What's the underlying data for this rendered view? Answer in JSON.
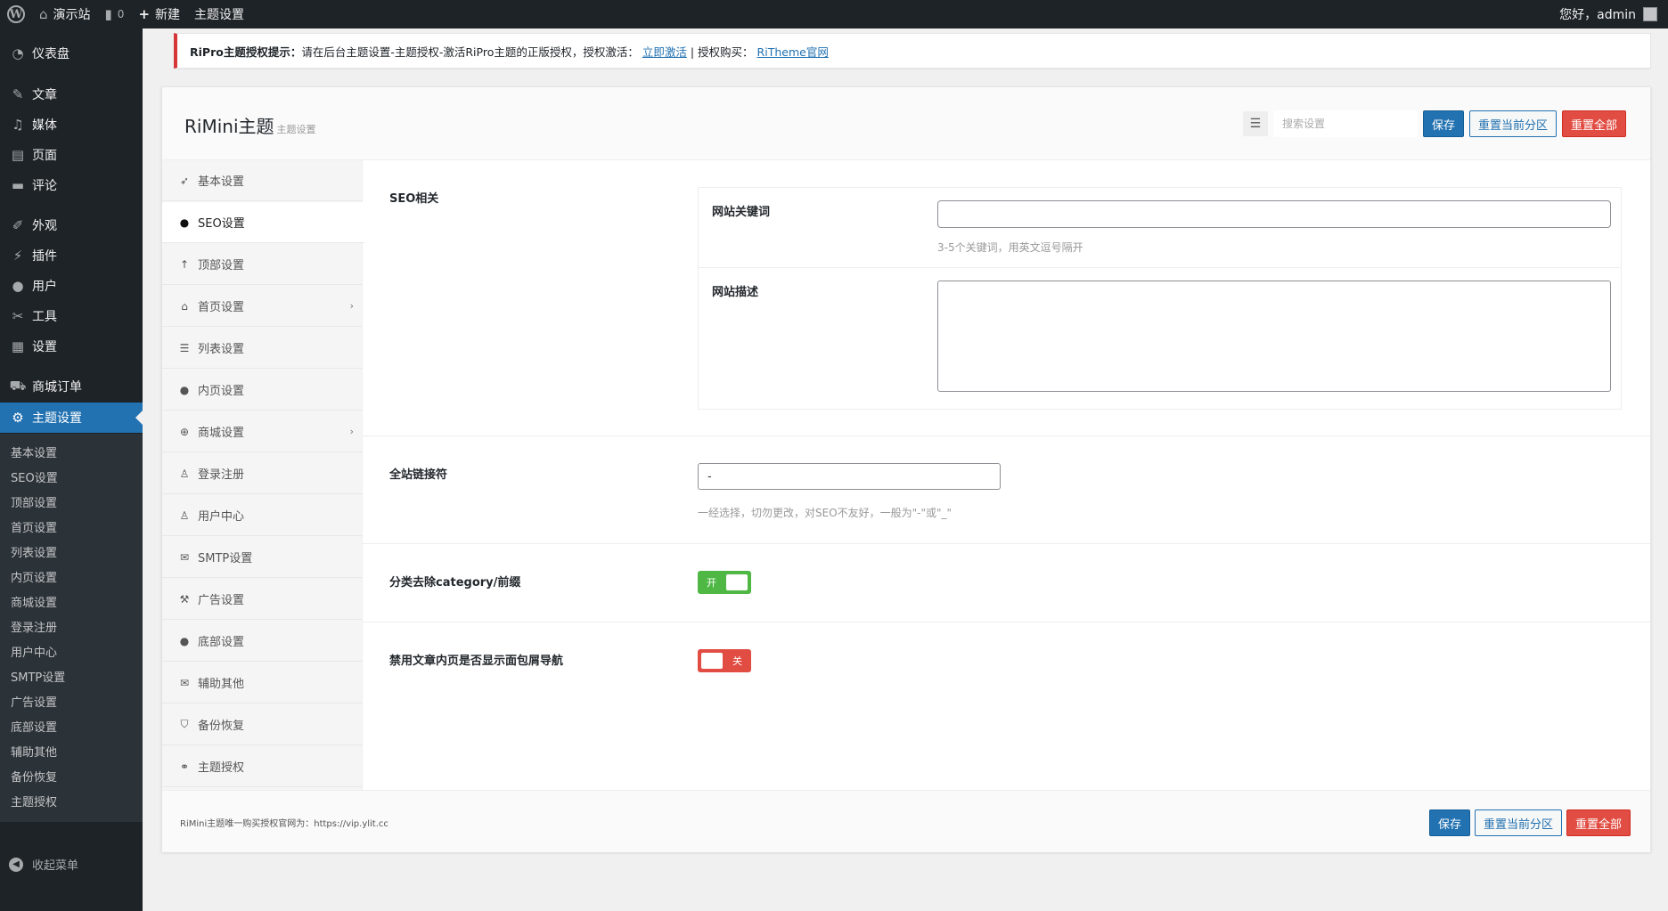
{
  "adminbar": {
    "site_name": "演示站",
    "comments_count": "0",
    "new_label": "新建",
    "theme_settings_label": "主题设置",
    "greeting": "您好，admin"
  },
  "sidebar": {
    "items": [
      {
        "label": "仪表盘",
        "icon": "dashboard-icon"
      },
      {
        "label": "文章",
        "icon": "pin-icon"
      },
      {
        "label": "媒体",
        "icon": "media-icon"
      },
      {
        "label": "页面",
        "icon": "page-icon"
      },
      {
        "label": "评论",
        "icon": "comment-icon"
      },
      {
        "label": "外观",
        "icon": "brush-icon"
      },
      {
        "label": "插件",
        "icon": "plugin-icon"
      },
      {
        "label": "用户",
        "icon": "user-icon"
      },
      {
        "label": "工具",
        "icon": "wrench-icon"
      },
      {
        "label": "设置",
        "icon": "settings-icon"
      },
      {
        "label": "商城订单",
        "icon": "cart-icon"
      },
      {
        "label": "主题设置",
        "icon": "gear-icon"
      }
    ],
    "submenu": [
      "基本设置",
      "SEO设置",
      "顶部设置",
      "首页设置",
      "列表设置",
      "内页设置",
      "商城设置",
      "登录注册",
      "用户中心",
      "SMTP设置",
      "广告设置",
      "底部设置",
      "辅助其他",
      "备份恢复",
      "主题授权"
    ],
    "collapse_label": "收起菜单"
  },
  "notice": {
    "title": "RiPro主题授权提示：",
    "text": "请在后台主题设置-主题授权-激活RiPro主题的正版授权，授权激活：",
    "activate_link": "立即激活",
    "separator": "| 授权购买：",
    "official_link": "RiTheme官网"
  },
  "panel": {
    "title": "RiMini主题",
    "subtitle": "主题设置",
    "search_placeholder": "搜索设置",
    "save_label": "保存",
    "reset_section_label": "重置当前分区",
    "reset_all_label": "重置全部"
  },
  "nav": {
    "items": [
      {
        "label": "基本设置",
        "icon": "rocket-icon"
      },
      {
        "label": "SEO设置",
        "icon": "dot-icon"
      },
      {
        "label": "顶部设置",
        "icon": "arrow-up-icon"
      },
      {
        "label": "首页设置",
        "icon": "home-icon"
      },
      {
        "label": "列表设置",
        "icon": "list-icon"
      },
      {
        "label": "内页设置",
        "icon": "dot-icon"
      },
      {
        "label": "商城设置",
        "icon": "plus-circle-icon"
      },
      {
        "label": "登录注册",
        "icon": "person-icon"
      },
      {
        "label": "用户中心",
        "icon": "person-icon"
      },
      {
        "label": "SMTP设置",
        "icon": "envelope-icon"
      },
      {
        "label": "广告设置",
        "icon": "gavel-icon"
      },
      {
        "label": "底部设置",
        "icon": "dot-icon"
      },
      {
        "label": "辅助其他",
        "icon": "envelope-icon"
      },
      {
        "label": "备份恢复",
        "icon": "shield-icon"
      },
      {
        "label": "主题授权",
        "icon": "handshake-icon"
      }
    ]
  },
  "content": {
    "seo_section_title": "SEO相关",
    "keywords_label": "网站关键词",
    "keywords_value": "",
    "keywords_desc": "3-5个关键词，用英文逗号隔开",
    "description_label": "网站描述",
    "description_value": "",
    "connector_title": "全站链接符",
    "connector_value": "-",
    "connector_desc": "一经选择，切勿更改，对SEO不友好，一般为\"-\"或\"_\"",
    "category_title": "分类去除category/前缀",
    "category_switch_label": "开",
    "breadcrumb_title": "禁用文章内页是否显示面包屑导航",
    "breadcrumb_switch_label": "关"
  },
  "footer": {
    "text": "RiMini主题唯一购买授权官网为：https://vip.ylit.cc",
    "save_label": "保存",
    "reset_section_label": "重置当前分区",
    "reset_all_label": "重置全部"
  },
  "colors": {
    "admin_dark": "#1d2327",
    "primary": "#2271b1",
    "danger": "#e14d43",
    "switch_on": "#4fb845"
  }
}
